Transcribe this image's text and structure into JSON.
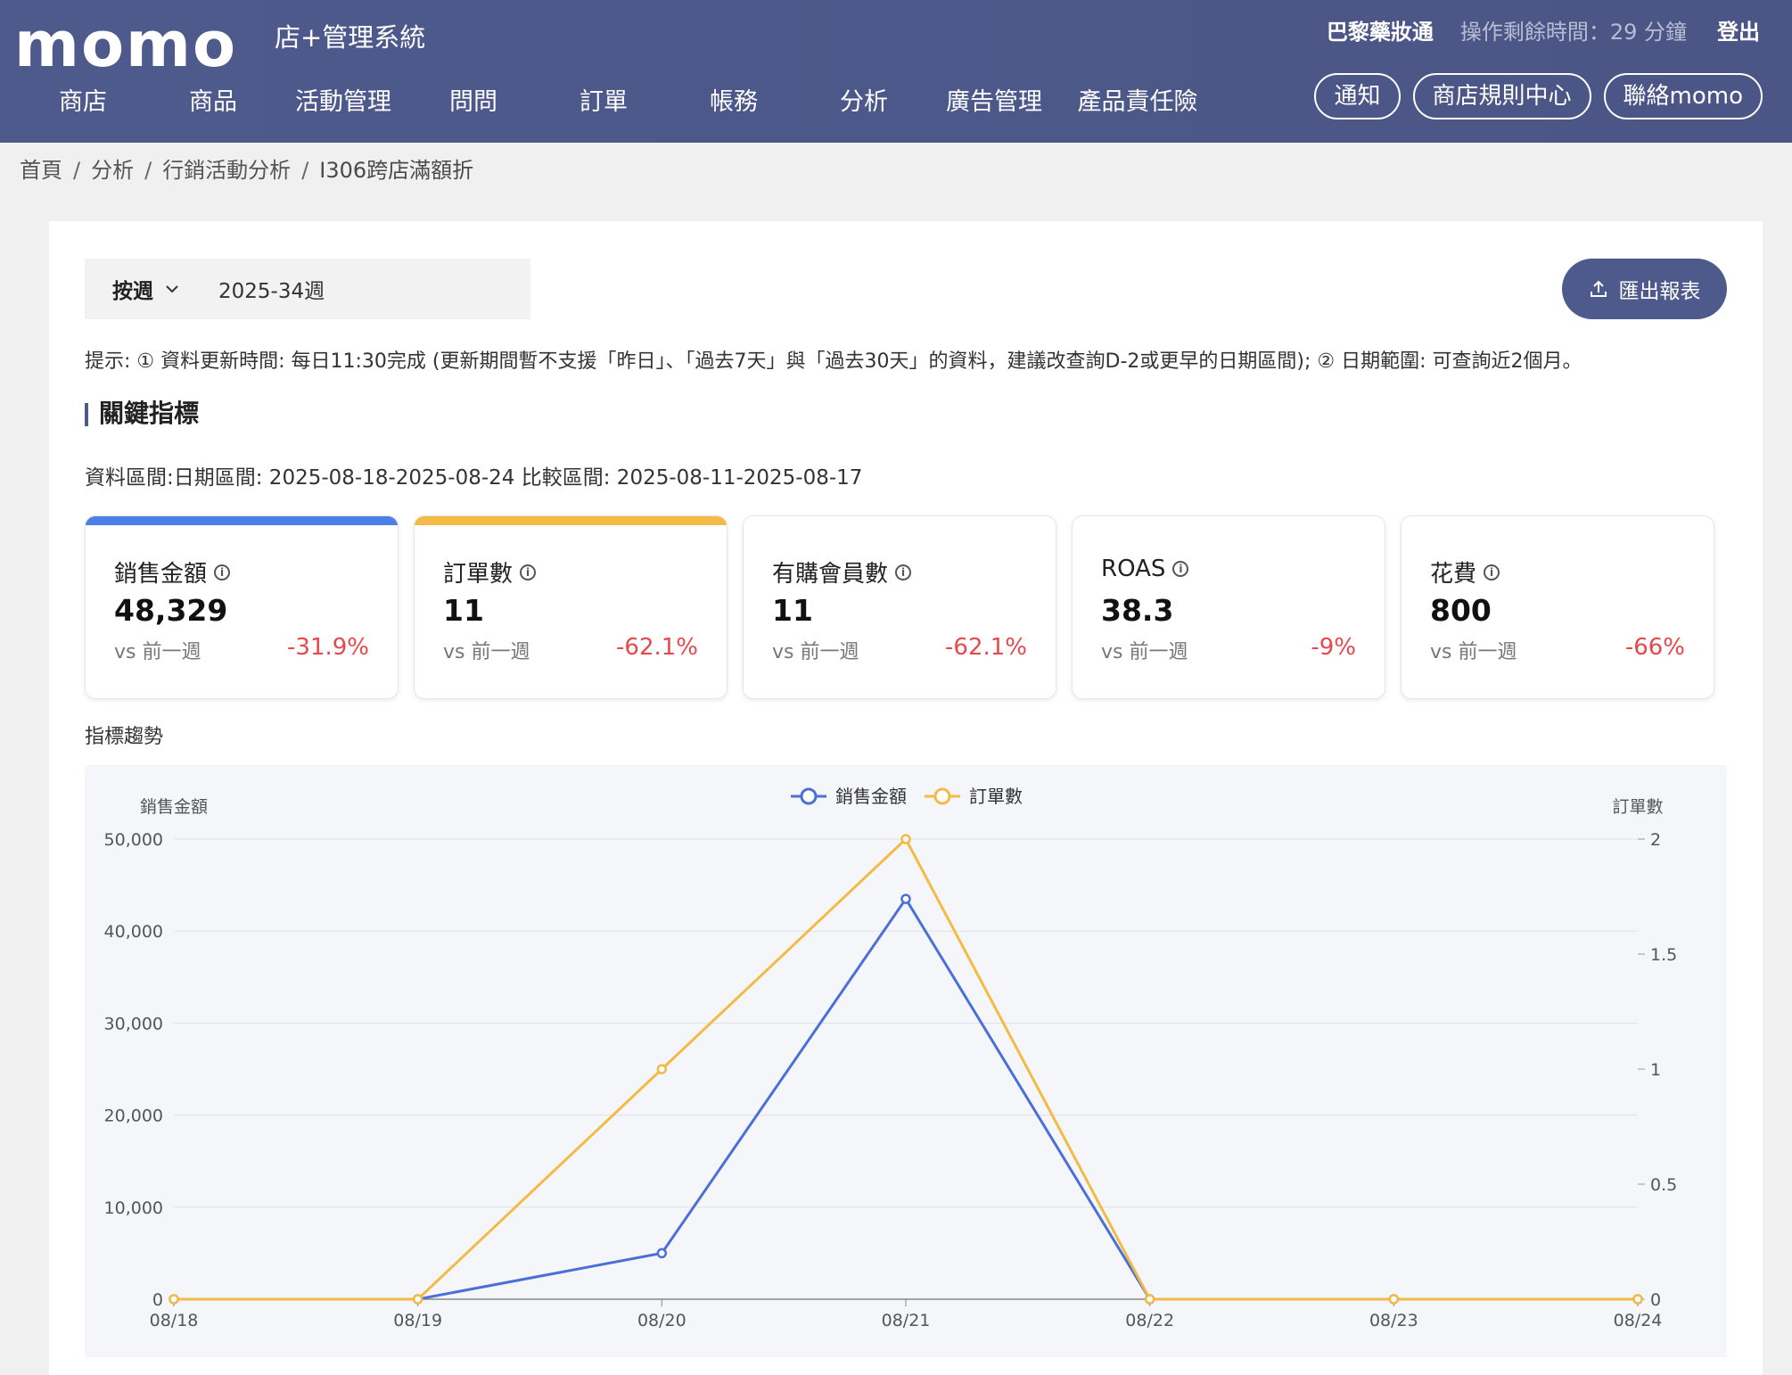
{
  "header": {
    "logo": "momo",
    "system_name": "店+管理系統",
    "shop_name": "巴黎藥妝通",
    "remaining": "操作剩餘時間：29 分鐘",
    "logout": "登出",
    "nav": [
      "商店",
      "商品",
      "活動管理",
      "問問",
      "訂單",
      "帳務",
      "分析",
      "廣告管理",
      "產品責任險"
    ],
    "pills": [
      "通知",
      "商店規則中心",
      "聯絡momo"
    ]
  },
  "breadcrumb": [
    "首頁",
    "分析",
    "行銷活動分析",
    "I306跨店滿額折"
  ],
  "filter": {
    "mode": "按週",
    "week": "2025-34週",
    "export": "匯出報表"
  },
  "tip": "提示: ① 資料更新時間: 每日11:30完成 (更新期間暫不支援「昨日」、「過去7天」與「過去30天」的資料，建議改查詢D-2或更早的日期區間); ② 日期範圍: 可查詢近2個月。",
  "section_title": "關鍵指標",
  "range": "資料區間:日期區間: 2025-08-18-2025-08-24 比較區間: 2025-08-11-2025-08-17",
  "kpis": [
    {
      "label": "銷售金額",
      "value": "48,329",
      "cmp": "vs 前一週",
      "change": "-31.9%",
      "accent": "#4a80e8"
    },
    {
      "label": "訂單數",
      "value": "11",
      "cmp": "vs 前一週",
      "change": "-62.1%",
      "accent": "#f3bb45"
    },
    {
      "label": "有購會員數",
      "value": "11",
      "cmp": "vs 前一週",
      "change": "-62.1%",
      "accent": ""
    },
    {
      "label": "ROAS",
      "value": "38.3",
      "cmp": "vs 前一週",
      "change": "-9%",
      "accent": ""
    },
    {
      "label": "花費",
      "value": "800",
      "cmp": "vs 前一週",
      "change": "-66%",
      "accent": ""
    }
  ],
  "trend_label": "指標趨勢",
  "chart_data": {
    "type": "line",
    "x": [
      "08/18",
      "08/19",
      "08/20",
      "08/21",
      "08/22",
      "08/23",
      "08/24"
    ],
    "series": [
      {
        "name": "銷售金額",
        "axis": "left",
        "color": "#4a6fd8",
        "values": [
          0,
          0,
          5000,
          43500,
          0,
          0,
          0
        ]
      },
      {
        "name": "訂單數",
        "axis": "right",
        "color": "#f3bb45",
        "values": [
          0,
          0,
          1,
          2,
          0,
          0,
          0
        ]
      }
    ],
    "ylabel_left": "銷售金額",
    "ylabel_right": "訂單數",
    "ylim_left": [
      0,
      50000
    ],
    "yticks_left": [
      "0",
      "10,000",
      "20,000",
      "30,000",
      "40,000",
      "50,000"
    ],
    "ylim_right": [
      0,
      2
    ],
    "yticks_right": [
      "0",
      "0.5",
      "1",
      "1.5",
      "2"
    ],
    "grid": true,
    "legend": "top-center"
  }
}
